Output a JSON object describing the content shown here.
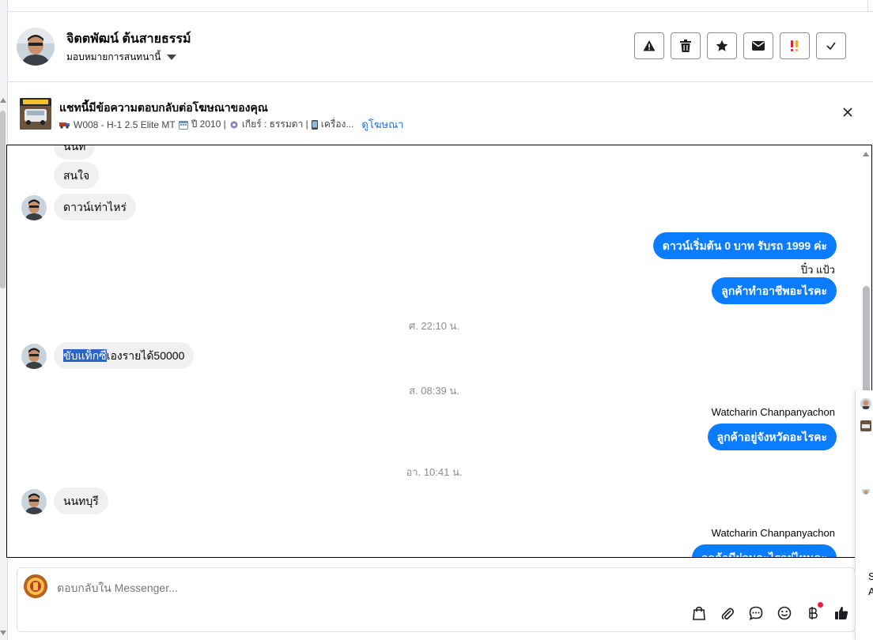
{
  "header": {
    "contact_name": "จิตตพัฒน์ ต้นสายธรรม์",
    "assign_label": "มอบหมายการสนทนานี้",
    "actions": [
      {
        "name": "alert",
        "icon": "warning-icon"
      },
      {
        "name": "delete",
        "icon": "trash-icon"
      },
      {
        "name": "star",
        "icon": "star-icon"
      },
      {
        "name": "mail",
        "icon": "envelope-icon"
      },
      {
        "name": "priority",
        "icon": "priority-icon"
      },
      {
        "name": "done",
        "icon": "check-icon"
      }
    ]
  },
  "ad": {
    "title": "แชทนี้มีข้อความตอบกลับต่อโฆษณาของคุณ",
    "meta_model": "W008 - H-1 2.5 Elite MT",
    "meta_year": "ปี 2010 |",
    "meta_gear": "เกียร์ : ธรรมดา |",
    "meta_engine": "เครื่อง...",
    "view_link": "ดูโฆษณา"
  },
  "chat": {
    "messages": [
      {
        "kind": "in",
        "text": "นนท"
      },
      {
        "kind": "in",
        "text": "สนใจ"
      },
      {
        "kind": "in",
        "text": "ดาวน์เท่าไหร่"
      },
      {
        "kind": "out",
        "text": "ดาวน์เริ่มต้น 0 บาท รับรถ 1999 ค่ะ"
      },
      {
        "kind": "sender",
        "text": "ปิ๋ว แป้ว"
      },
      {
        "kind": "out",
        "text": "ลูกค้าทำอาชีพอะไรคะ"
      },
      {
        "kind": "ts",
        "text": "ศ. 22:10 น."
      },
      {
        "kind": "in",
        "text_hl": "ขับแท็กซี่",
        "text_rest": "เองรายได้50000"
      },
      {
        "kind": "ts",
        "text": "ส. 08:39 น."
      },
      {
        "kind": "sender",
        "text": "Watcharin Chanpanyachon"
      },
      {
        "kind": "out",
        "text": "ลูกค้าอยู่จังหวัดอะไรคะ"
      },
      {
        "kind": "ts",
        "text": "อา. 10:41 น."
      },
      {
        "kind": "in",
        "text": "นนทบุรี"
      },
      {
        "kind": "sender",
        "text": "Watcharin Chanpanyachon"
      },
      {
        "kind": "out",
        "text": "ลูกค้ามีผ่อนอะไรอยู่ไหมคะ"
      }
    ]
  },
  "composer": {
    "placeholder": "ตอบกลับใน Messenger...",
    "tools": [
      "shop-bag-icon",
      "attach-icon",
      "chat-bubble-icon",
      "emoji-icon",
      "baht-icon",
      "thumbs-up-icon"
    ]
  },
  "side": {
    "letter_s": "S",
    "letter_a": "A"
  },
  "colors": {
    "accent": "#0a7cff",
    "bubble_in": "#f0f0f0",
    "timestamp": "#8a8d91",
    "link": "#1b74e4"
  }
}
